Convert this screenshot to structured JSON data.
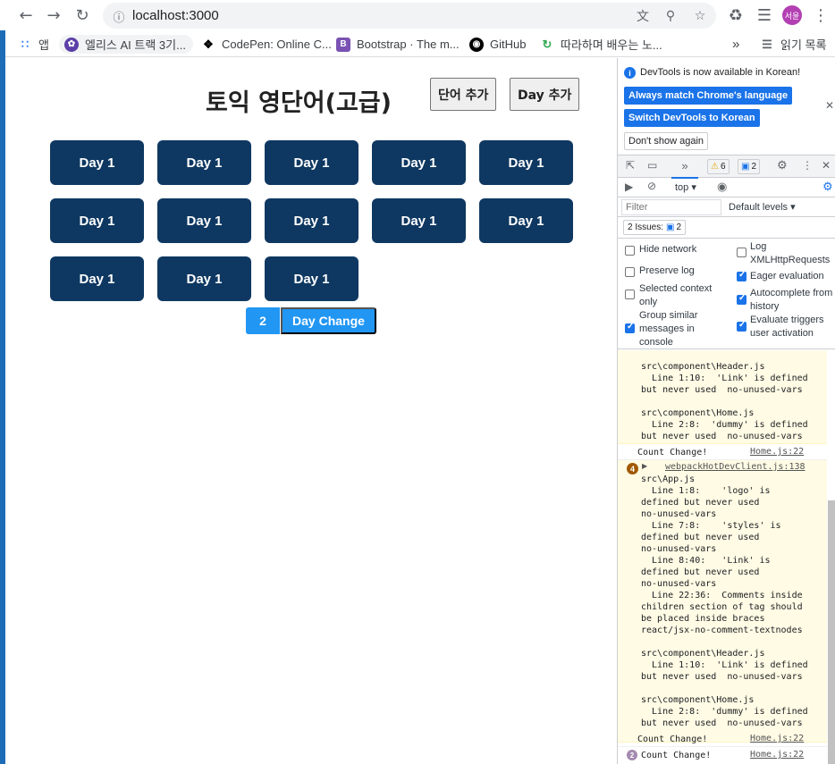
{
  "browser": {
    "url": "localhost:3000",
    "profile_label": "서윤",
    "bookmarks": [
      {
        "label": "앱",
        "icon": "apps-grid-icon",
        "color": "#4285f4"
      },
      {
        "label": "엘리스 AI 트랙 3기...",
        "icon": "elice-icon",
        "color": "#5c3fa8"
      },
      {
        "label": "CodePen: Online C...",
        "icon": "codepen-icon",
        "color": "#000000"
      },
      {
        "label": "Bootstrap · The m...",
        "icon": "bootstrap-icon",
        "color": "#7952b3"
      },
      {
        "label": "GitHub",
        "icon": "github-icon",
        "color": "#000000"
      },
      {
        "label": "따라하며 배우는 노...",
        "icon": "cycle-icon",
        "color": "#34a853"
      }
    ],
    "overflow_label": "»",
    "reading_list_label": "읽기 목록"
  },
  "page": {
    "title": "토익 영단어(고급)",
    "add_word_label": "단어 추가",
    "add_day_label": "Day 추가",
    "day_buttons": [
      "Day 1",
      "Day 1",
      "Day 1",
      "Day 1",
      "Day 1",
      "Day 1",
      "Day 1",
      "Day 1",
      "Day 1",
      "Day 1",
      "Day 1",
      "Day 1",
      "Day 1"
    ],
    "count_value": "2",
    "day_change_label": "Day Change",
    "colors": {
      "day_button": "#0e3861",
      "change_button": "#2196f3"
    }
  },
  "devtools": {
    "notice": "DevTools is now available in Korean!",
    "match_language_label": "Always match Chrome's language",
    "switch_korean_label": "Switch DevTools to Korean",
    "dont_show_label": "Don't show again",
    "warnings_count": "6",
    "messages_count": "2",
    "context_label": "top",
    "filter_placeholder": "Filter",
    "levels_label": "Default levels",
    "issues_label": "2 Issues:",
    "issues_count": "2",
    "settings": {
      "hide_network": "Hide network",
      "log_xhr": "Log XMLHttpRequests",
      "preserve_log": "Preserve log",
      "eager_eval": "Eager evaluation",
      "selected_context": "Selected context only",
      "autocomplete": "Autocomplete from history",
      "group_similar": "Group similar messages in console",
      "evaluate_triggers": "Evaluate triggers user activation"
    },
    "console": {
      "warn_block_1": "src\\component\\Header.js\n  Line 1:10:  'Link' is defined\nbut never used  no-unused-vars\n\nsrc\\component\\Home.js\n  Line 2:8:  'dummy' is defined\nbut never used  no-unused-vars",
      "log_1_text": "Count Change!",
      "log_1_link": "Home.js:22",
      "warn_badge": "4",
      "warn_link": "webpackHotDevClient.js:138",
      "warn_block_2": "src\\App.js\n  Line 1:8:    'logo' is\ndefined but never used\nno-unused-vars\n  Line 7:8:    'styles' is\ndefined but never used\nno-unused-vars\n  Line 8:40:   'Link' is\ndefined but never used\nno-unused-vars\n  Line 22:36:  Comments inside\nchildren section of tag should\nbe placed inside braces\nreact/jsx-no-comment-textnodes\n\nsrc\\component\\Header.js\n  Line 1:10:  'Link' is defined\nbut never used  no-unused-vars\n\nsrc\\component\\Home.js\n  Line 2:8:  'dummy' is defined\nbut never used  no-unused-vars",
      "log_2_text": "Count Change!",
      "log_2_link": "Home.js:22",
      "log_3_badge": "2",
      "log_3_text": "Count Change!",
      "log_3_link": "Home.js:22"
    }
  }
}
